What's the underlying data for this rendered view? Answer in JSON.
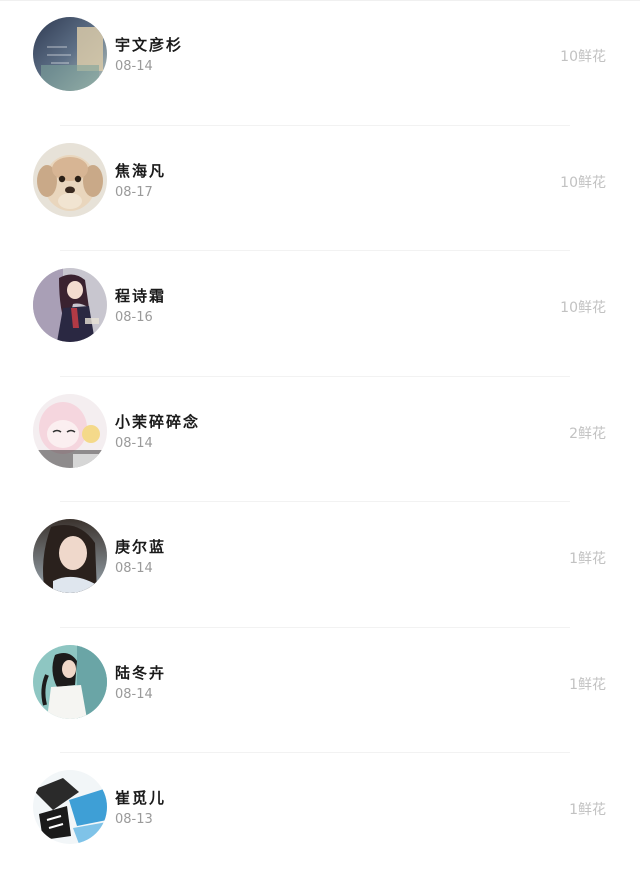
{
  "friends": [
    {
      "name": "宇文彦杉",
      "date": "08-14",
      "flowers": "10鲜花",
      "avatar": "photo-note-avatar"
    },
    {
      "name": "焦海凡",
      "date": "08-17",
      "flowers": "10鲜花",
      "avatar": "puppy-avatar"
    },
    {
      "name": "程诗霜",
      "date": "08-16",
      "flowers": "10鲜花",
      "avatar": "anime-girl-avatar"
    },
    {
      "name": "小茉碎碎念",
      "date": "08-14",
      "flowers": "2鲜花",
      "avatar": "pink-anime-avatar"
    },
    {
      "name": "庚尔蓝",
      "date": "08-14",
      "flowers": "1鲜花",
      "avatar": "girl-portrait-avatar"
    },
    {
      "name": "陆冬卉",
      "date": "08-14",
      "flowers": "1鲜花",
      "avatar": "girl-profile-avatar"
    },
    {
      "name": "崔觅儿",
      "date": "08-13",
      "flowers": "1鲜花",
      "avatar": "manga-avatar"
    }
  ],
  "colors": {
    "name_text": "#1a1a1a",
    "date_text": "#9a9a9a",
    "flowers_text": "#c2c2c2",
    "divider": "#f2f2f2"
  }
}
